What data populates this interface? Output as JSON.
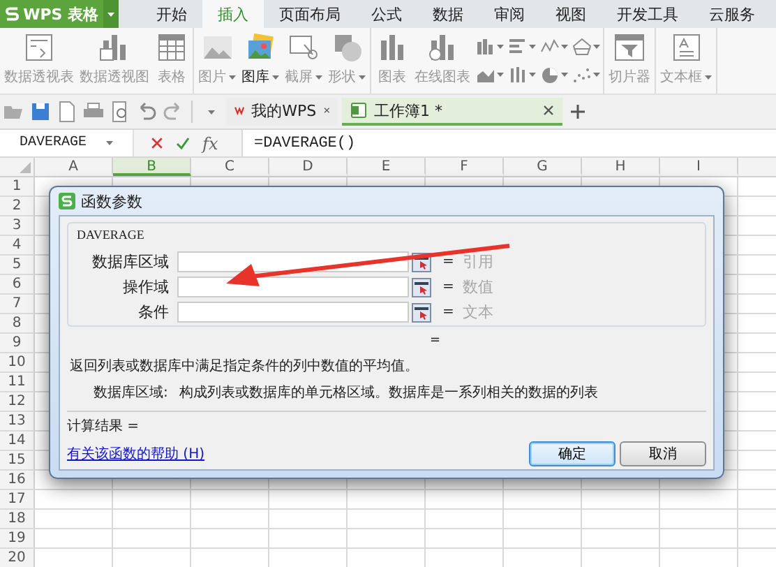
{
  "app_button": {
    "label": "WPS 表格"
  },
  "ribbon_tabs": [
    {
      "label": "开始",
      "selected": false
    },
    {
      "label": "插入",
      "selected": true
    },
    {
      "label": "页面布局",
      "selected": false
    },
    {
      "label": "公式",
      "selected": false
    },
    {
      "label": "数据",
      "selected": false
    },
    {
      "label": "审阅",
      "selected": false
    },
    {
      "label": "视图",
      "selected": false
    },
    {
      "label": "开发工具",
      "selected": false
    },
    {
      "label": "云服务",
      "selected": false
    }
  ],
  "ribbon_groups": [
    {
      "kind": "pivot",
      "items": [
        {
          "label": "数据透视表",
          "disabled": true,
          "dropdown": false
        },
        {
          "label": "数据透视图",
          "disabled": true,
          "dropdown": false
        },
        {
          "label": "表格",
          "disabled": true,
          "dropdown": false
        }
      ]
    },
    {
      "kind": "media",
      "items": [
        {
          "label": "图片",
          "disabled": true,
          "dropdown": true
        },
        {
          "label": "图库",
          "disabled": false,
          "dropdown": true
        },
        {
          "label": "截屏",
          "disabled": true,
          "dropdown": true
        },
        {
          "label": "形状",
          "disabled": true,
          "dropdown": true
        }
      ]
    },
    {
      "kind": "charts",
      "items": [
        {
          "label": "图表",
          "disabled": true,
          "dropdown": false
        },
        {
          "label": "在线图表",
          "disabled": true,
          "dropdown": false
        }
      ]
    },
    {
      "kind": "slicer",
      "items": [
        {
          "label": "切片器",
          "disabled": true,
          "dropdown": false
        }
      ]
    },
    {
      "kind": "text",
      "items": [
        {
          "label": "文本框",
          "disabled": true,
          "dropdown": true
        }
      ]
    }
  ],
  "doc_tabs": [
    {
      "label": "我的WPS",
      "selected": false
    },
    {
      "label": "工作簿1 *",
      "selected": true
    }
  ],
  "formula_bar": {
    "name_box": "DAVERAGE",
    "function_label": "fx",
    "formula": "=DAVERAGE()"
  },
  "sheet": {
    "columns": [
      {
        "label": "A",
        "selected": false
      },
      {
        "label": "B",
        "selected": true
      },
      {
        "label": "C",
        "selected": false
      },
      {
        "label": "D",
        "selected": false
      },
      {
        "label": "E",
        "selected": false
      },
      {
        "label": "F",
        "selected": false
      },
      {
        "label": "G",
        "selected": false
      },
      {
        "label": "H",
        "selected": false
      },
      {
        "label": "I",
        "selected": false
      }
    ],
    "rows": [
      "1",
      "2",
      "3",
      "4",
      "5",
      "6",
      "7",
      "8",
      "9",
      "10",
      "11",
      "12",
      "13",
      "14",
      "15",
      "16",
      "17",
      "18",
      "19",
      "20"
    ]
  },
  "dialog": {
    "title": "函数参数",
    "function_name": "DAVERAGE",
    "params": [
      {
        "label": "数据库区域",
        "eq": "=",
        "hint": "引用"
      },
      {
        "label": "操作域",
        "eq": "=",
        "hint": "数值"
      },
      {
        "label": "条件",
        "eq": "=",
        "hint": "文本"
      }
    ],
    "result_preview": "=",
    "description": "返回列表或数据库中满足指定条件的列中数值的平均值。",
    "param_label": "数据库区域:",
    "param_description": "构成列表或数据库的单元格区域。数据库是一系列相关的数据的列表",
    "result_label": "计算结果 =",
    "help_link": "有关该函数的帮助 (H)",
    "buttons": [
      {
        "label": "确定",
        "default": true
      },
      {
        "label": "取消",
        "default": false
      }
    ]
  }
}
